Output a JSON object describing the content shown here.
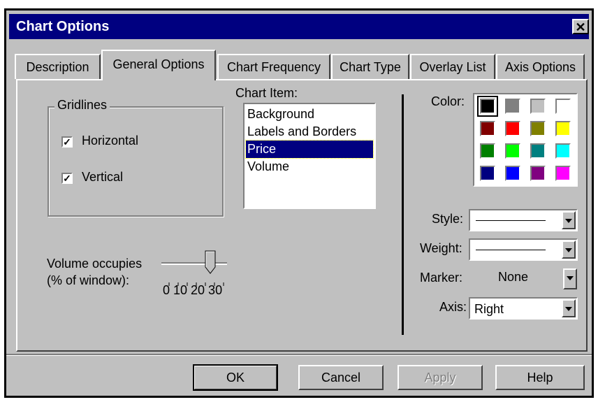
{
  "window": {
    "title": "Chart Options",
    "close_label": "✕"
  },
  "tabs": [
    {
      "label": "Description"
    },
    {
      "label": "General Options"
    },
    {
      "label": "Chart Frequency"
    },
    {
      "label": "Chart Type"
    },
    {
      "label": "Overlay List"
    },
    {
      "label": "Axis Options"
    }
  ],
  "gridlines": {
    "group_label": "Gridlines",
    "horizontal_label": "Horizontal",
    "horizontal_checked": true,
    "vertical_label": "Vertical",
    "vertical_checked": true,
    "check_glyph": "✓"
  },
  "chart_item": {
    "label": "Chart Item:",
    "items": [
      "Background",
      "Labels and Borders",
      "Price",
      "Volume"
    ],
    "selected": "Price"
  },
  "volume": {
    "label_line1": "Volume occupies",
    "label_line2": "(% of  window):",
    "ticks_label": "0 10 20 30",
    "value_percent": 20
  },
  "color": {
    "label": "Color:",
    "swatches": [
      "#000000",
      "#808080",
      "#c0c0c0",
      "#ffffff",
      "#800000",
      "#ff0000",
      "#808000",
      "#ffff00",
      "#008000",
      "#00ff00",
      "#008080",
      "#00ffff",
      "#000080",
      "#0000ff",
      "#800080",
      "#ff00ff"
    ],
    "selected_index": 0
  },
  "style": {
    "label": "Style:"
  },
  "weight": {
    "label": "Weight:"
  },
  "marker": {
    "label": "Marker:",
    "value": "None"
  },
  "axis": {
    "label": "Axis:",
    "value": "Right"
  },
  "buttons": {
    "ok": "OK",
    "cancel": "Cancel",
    "apply": "Apply",
    "help": "Help"
  }
}
